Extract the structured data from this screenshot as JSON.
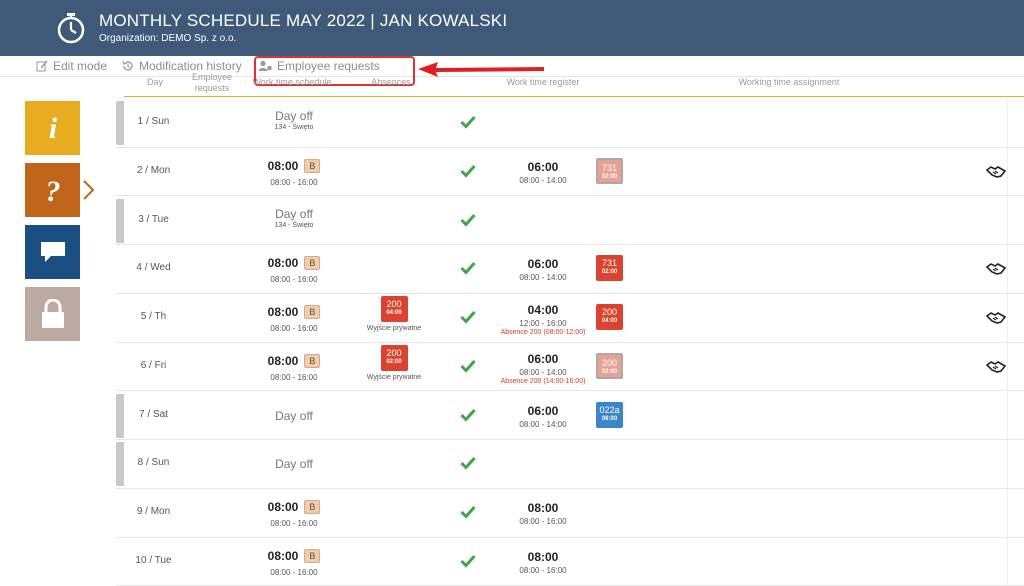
{
  "header": {
    "title": "MONTHLY SCHEDULE MAY 2022 | JAN KOWALSKI",
    "organization": "Organization: DEMO Sp. z o.o."
  },
  "toolbar": {
    "edit_mode": "Edit mode",
    "modification_history": "Modification history",
    "employee_requests": "Employee requests"
  },
  "columns": {
    "day": "Day",
    "employee_requests": "Employee requests",
    "work_time_schedule": "Work time schedule",
    "absences": "Absences",
    "work_time_register": "Work time register",
    "working_time_assignment": "Working time assignment"
  },
  "sidebar": {
    "info_icon": "info-icon",
    "question_icon": "question-icon",
    "chat_icon": "chat-icon",
    "lock_icon": "lock-icon"
  },
  "colors": {
    "header_bg": "#3e5a78",
    "info": "#e8ac20",
    "question": "#c0651a",
    "chat": "#1b4f82",
    "lock": "#bcaaa2",
    "absence_red": "#d9432f",
    "assign_blue": "#3a86c8",
    "check_green": "#3fa545"
  },
  "rows": [
    {
      "day": "1 / Sun",
      "sched_dayoff": "Day off",
      "sched_sub": "134 - Święto"
    },
    {
      "day": "2 / Mon",
      "sched_time": "08:00",
      "badge": "B",
      "sched_hours": "08:00 - 16:00",
      "reg_time": "06:00",
      "reg_hours": "08:00 - 14:00",
      "assign_code": "731",
      "assign_sub": "02:00"
    },
    {
      "day": "3 / Tue",
      "sched_dayoff": "Day off",
      "sched_sub": "134 - Święto"
    },
    {
      "day": "4 / Wed",
      "sched_time": "08:00",
      "badge": "B",
      "sched_hours": "08:00 - 16:00",
      "reg_time": "06:00",
      "reg_hours": "08:00 - 14:00",
      "assign_code": "731",
      "assign_sub": "02:00"
    },
    {
      "day": "5 / Th",
      "sched_time": "08:00",
      "badge": "B",
      "sched_hours": "08:00 - 16:00",
      "abs_code": "200",
      "abs_sub": "04:00",
      "abs_label": "Wyjście prywatne",
      "reg_time": "04:00",
      "reg_hours": "12:00 - 16:00",
      "reg_abs": "Absence 200 (08:00-12:00)",
      "assign_code": "200",
      "assign_sub": "04:00"
    },
    {
      "day": "6 / Fri",
      "sched_time": "08:00",
      "badge": "B",
      "sched_hours": "08:00 - 16:00",
      "abs_code": "200",
      "abs_sub": "02:00",
      "abs_label": "Wyjście prywatne",
      "reg_time": "06:00",
      "reg_hours": "08:00 - 14:00",
      "reg_abs": "Absence 200 (14:00-16:00)",
      "assign_code": "200",
      "assign_sub": "02:00"
    },
    {
      "day": "7 / Sat",
      "sched_dayoff": "Day off",
      "reg_time": "06:00",
      "reg_hours": "08:00 - 14:00",
      "assign_code": "022a",
      "assign_sub": "06:00"
    },
    {
      "day": "8 / Sun",
      "sched_dayoff": "Day off"
    },
    {
      "day": "9 / Mon",
      "sched_time": "08:00",
      "badge": "B",
      "sched_hours": "08:00 - 16:00",
      "reg_time": "08:00",
      "reg_hours": "08:00 - 16:00"
    },
    {
      "day": "10 / Tue",
      "sched_time": "08:00",
      "badge": "B",
      "sched_hours": "08:00 - 16:00",
      "reg_time": "08:00",
      "reg_hours": "08:00 - 16:00"
    }
  ]
}
